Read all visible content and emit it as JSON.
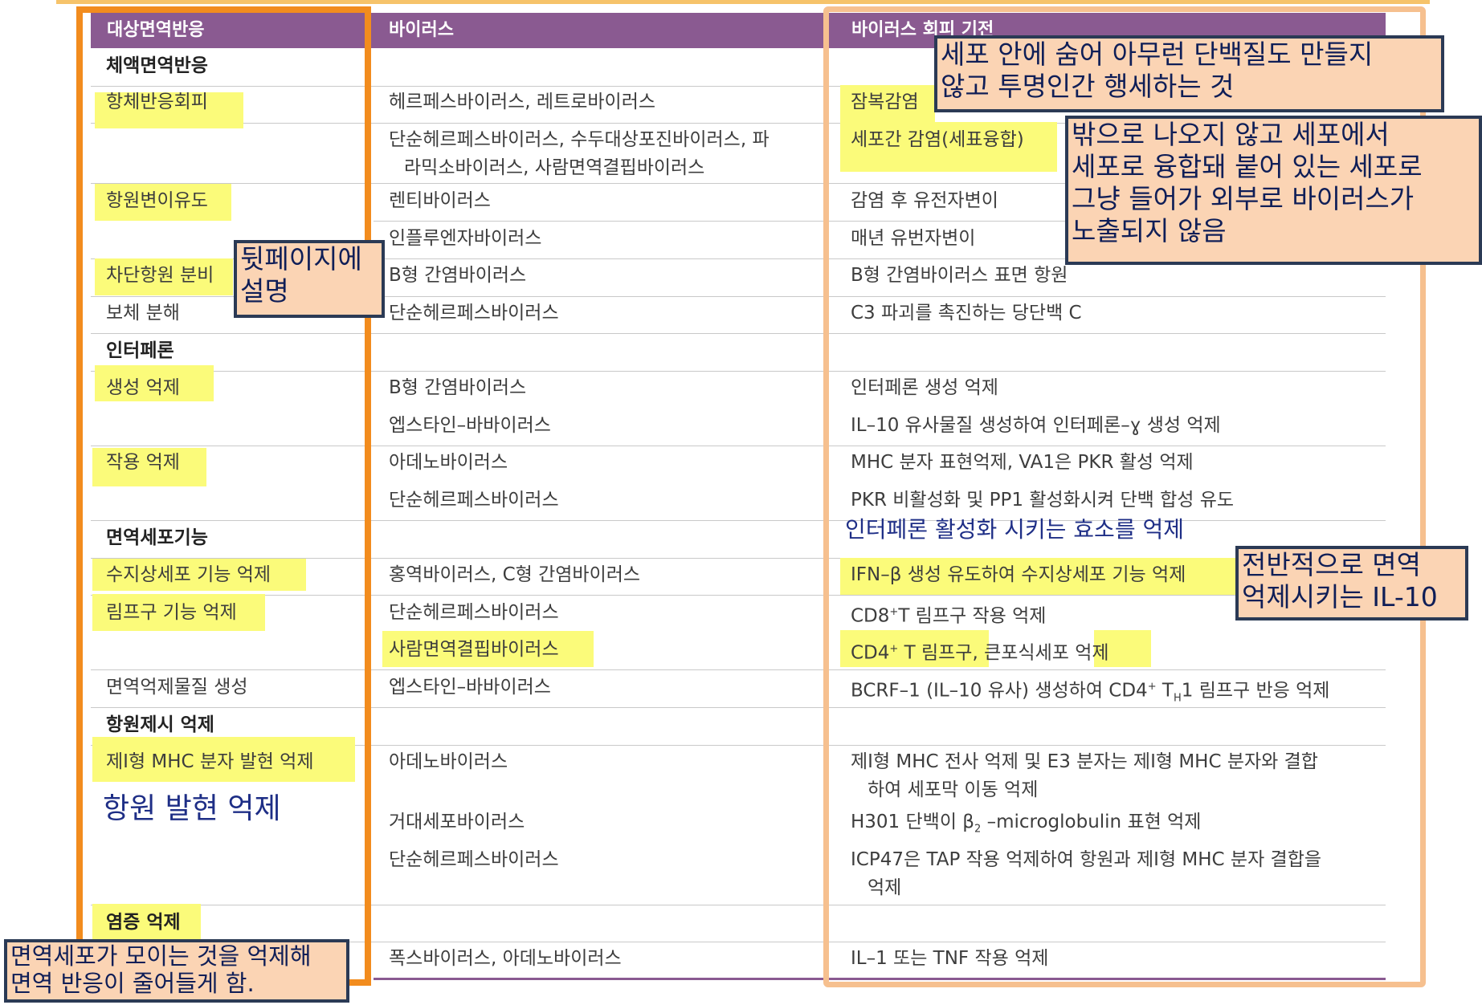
{
  "headers": {
    "col1": "대상면역반응",
    "col2": "바이러스",
    "col3": "바이러스 회피 기전"
  },
  "sections": {
    "humoral": "체액면역반응",
    "interferon": "인터페론",
    "immune_cell": "면역세포기능",
    "antigen": "항원제시 억제",
    "inflammation": "염증 억제"
  },
  "rows": [
    {
      "target": "항체반응회피",
      "virus": "헤르페스바이러스, 레트로바이러스",
      "mechanism": "잠복감염"
    },
    {
      "target": "",
      "virus": "단순헤르페스바이러스, 수두대상포진바이러스, 파",
      "virus2": "라믹소바이러스, 사람면역결핍바이러스",
      "mechanism": "세포간 감염(세표융합)"
    },
    {
      "target": "항원변이유도",
      "virus": "렌티바이러스",
      "mechanism": "감염 후 유전자변이"
    },
    {
      "target": "",
      "virus": "인플루엔자바이러스",
      "mechanism": "매년 유번자변이"
    },
    {
      "target": "차단항원 분비",
      "virus": "B형 간염바이러스",
      "mechanism": "B형 간염바이러스 표면 항원"
    },
    {
      "target": "보체 분해",
      "virus": "단순헤르페스바이러스",
      "mechanism": "C3 파괴를 촉진하는 당단백 C"
    },
    {
      "target": "생성 억제",
      "virus": "B형 간염바이러스",
      "mechanism": "인터페론 생성 억제"
    },
    {
      "target": "",
      "virus": "엡스타인–바바이러스",
      "mechanism": "IL–10 유사물질 생성하여 인터페론–ɣ 생성 억제"
    },
    {
      "target": "작용 억제",
      "virus": "아데노바이러스",
      "mechanism": "MHC 분자 표현억제, VA1은 PKR 활성 억제"
    },
    {
      "target": "",
      "virus": "단순헤르페스바이러스",
      "mechanism": "PKR 비활성화 및 PP1 활성화시켜 단백 합성 유도"
    },
    {
      "target": "수지상세포 기능 억제",
      "virus": "홍역바이러스, C형 간염바이러스",
      "mechanism": "IFN–β 생성 유도하여 수지상세포 기능 억제"
    },
    {
      "target": "림프구 기능 억제",
      "virus": "단순헤르페스바이러스",
      "mech_a": "CD8",
      "mech_sup": "+",
      "mech_b": "T 림프구 작용 억제"
    },
    {
      "target": "",
      "virus": "사람면역결핍바이러스",
      "mech_a": "CD4",
      "mech_sup": "+",
      "mech_b": " T 림프구, 큰포식세포 억제"
    },
    {
      "target": "면역억제물질 생성",
      "virus": "엡스타인–바바이러스",
      "mech_a": "BCRF–1 (IL–10 유사) 생성하여 CD4",
      "mech_sup": "+",
      "mech_c": " T",
      "mech_sub": "H",
      "mech_d": "1 림프구 반응 억제"
    },
    {
      "target": "제I형 MHC 분자 발현 억제",
      "virus": "아데노바이러스",
      "mechanism": "제I형 MHC 전사 억제 및 E3 분자는 제I형 MHC 분자와 결합",
      "mechanism2": "하여 세포막 이동 억제"
    },
    {
      "target": "",
      "virus": "거대세포바이러스",
      "mech_a": "H301 단백이 β",
      "mech_sub": "2",
      "mech_b": " –microglobulin 표현 억제"
    },
    {
      "target": "",
      "virus": "단순헤르페스바이러스",
      "mechanism": "ICP47은 TAP 작용 억제하여 항원과 제I형 MHC 분자 결합을",
      "mechanism2": "억제"
    },
    {
      "target": "",
      "virus": "폭스바이러스, 아데노바이러스",
      "mechanism": "IL–1 또는 TNF 작용 억제"
    }
  ],
  "annotations": {
    "latent": [
      "세포 안에 숨어 아무런 단백질도 만들지",
      "않고 투명인간 행세하는 것"
    ],
    "fusion": [
      "밖으로 나오지 않고 세포에서",
      "세포로 융합돼 붙어 있는 세포로",
      "그냥 들어가 외부로 바이러스가",
      "노출되지 않음"
    ],
    "next_page": [
      "뒷페이지에",
      "설명"
    ],
    "pkr": "인터페론 활성화 시키는 효소를 억제",
    "il10": [
      "전반적으로 면역",
      "억제시키는 IL-10"
    ],
    "antigen": "항원 발현 억제",
    "inflammation": [
      "면역세포가 모이는 것을 억제해",
      "면역 반응이 줄어들게 함."
    ]
  },
  "colors": {
    "header": "#8a5a91",
    "highlight": "#fbfb7a",
    "left_frame": "#f28c1e",
    "right_frame": "#f6c08f",
    "note_fill": "#fbd4b4",
    "note_border": "#2b3a55",
    "annotation_text": "#1e2e86"
  }
}
